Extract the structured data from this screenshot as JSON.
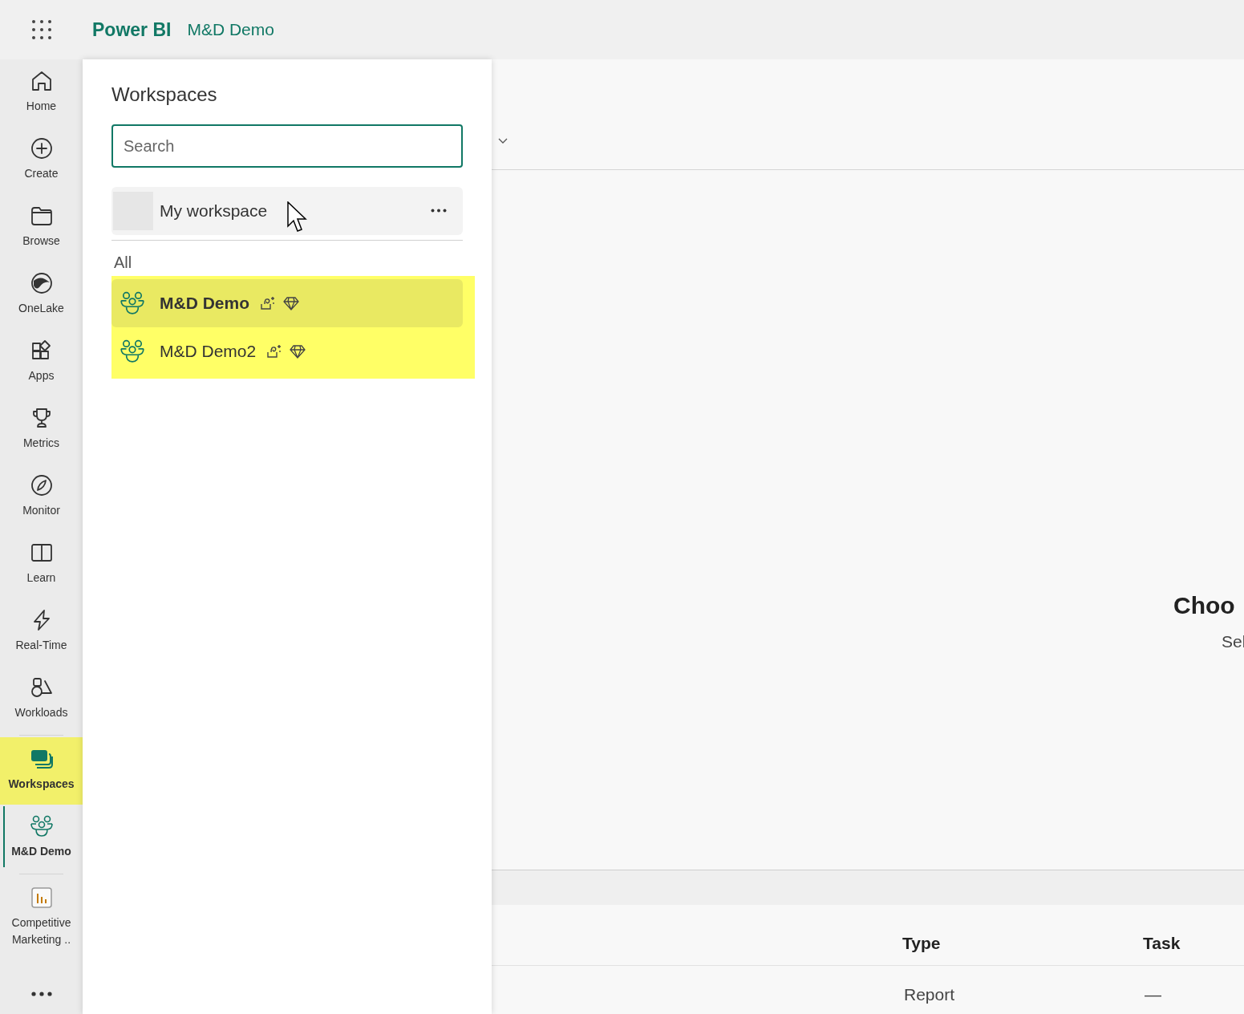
{
  "app_bar": {
    "product": "Power BI",
    "workspace": "M&D Demo"
  },
  "nav": {
    "groups": [
      [
        {
          "label": "Home",
          "selected": false,
          "highlighted": false
        },
        {
          "label": "Create",
          "selected": false,
          "highlighted": false
        },
        {
          "label": "Browse",
          "selected": false,
          "highlighted": false
        },
        {
          "label": "OneLake",
          "selected": false,
          "highlighted": false
        },
        {
          "label": "Apps",
          "selected": false,
          "highlighted": false
        },
        {
          "label": "Metrics",
          "selected": false,
          "highlighted": false
        },
        {
          "label": "Monitor",
          "selected": false,
          "highlighted": false
        },
        {
          "label": "Learn",
          "selected": false,
          "highlighted": false
        },
        {
          "label": "Real-Time",
          "selected": false,
          "highlighted": false
        },
        {
          "label": "Workloads",
          "selected": false,
          "highlighted": false
        }
      ],
      [
        {
          "label": "Workspaces",
          "selected": false,
          "highlighted": true
        },
        {
          "label": "M&D Demo",
          "selected": true,
          "highlighted": false
        }
      ],
      [
        {
          "label": "Competitive Marketing ..",
          "selected": false,
          "highlighted": false
        }
      ]
    ]
  },
  "workspaces_panel": {
    "title": "Workspaces",
    "search": {
      "placeholder": "Search"
    },
    "my_workspace": {
      "label": "My workspace"
    },
    "section": "All",
    "highlighted": true,
    "items": [
      {
        "name": "M&D Demo",
        "selected": true
      },
      {
        "name": "M&D Demo2",
        "selected": false
      }
    ]
  },
  "main": {
    "heading": "Choo",
    "subtext": "Sel",
    "table": {
      "columns": [
        "Type",
        "Task"
      ],
      "rows": [
        [
          "Report",
          "—"
        ]
      ]
    }
  }
}
